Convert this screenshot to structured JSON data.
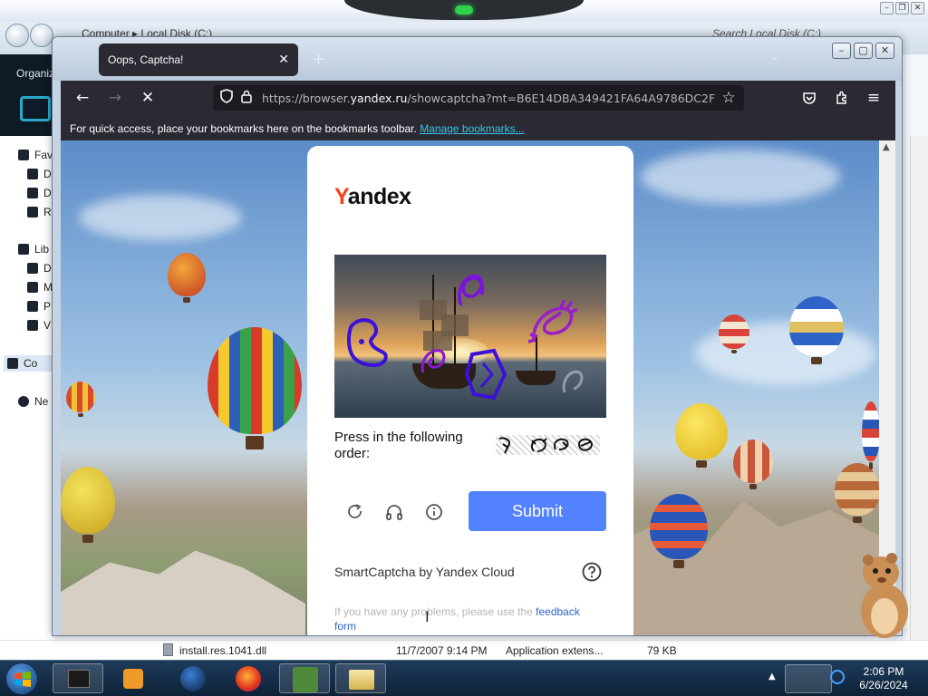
{
  "explorer": {
    "breadcrumbs": [
      "Computer",
      "Local Disk (C:)"
    ],
    "search_placeholder": "Search Local Disk (C:)",
    "toolbar_organize": "Organiz",
    "sidebar": [
      {
        "label": "Fav",
        "kind": "group"
      },
      {
        "label": "D",
        "kind": "item"
      },
      {
        "label": "D",
        "kind": "item"
      },
      {
        "label": "R",
        "kind": "item"
      },
      {
        "label": "Lib",
        "kind": "group"
      },
      {
        "label": "D",
        "kind": "item"
      },
      {
        "label": "M",
        "kind": "item"
      },
      {
        "label": "P",
        "kind": "item"
      },
      {
        "label": "V",
        "kind": "item"
      },
      {
        "label": "Co",
        "kind": "selected"
      },
      {
        "label": "Ne",
        "kind": "group"
      }
    ],
    "file_row": {
      "name": "install.res.1041.dll",
      "date": "11/7/2007 9:14 PM",
      "type": "Application extens...",
      "size": "79 KB"
    }
  },
  "browser": {
    "tab_title": "Oops, Captcha!",
    "url_prefix": "https://browser.",
    "url_host": "yandex.ru",
    "url_rest": "/showcaptcha?mt=B6E14DBA349421FA64A9786DC2F",
    "bookmarks_message": "For quick access, place your bookmarks here on the bookmarks toolbar.",
    "bookmarks_link": "Manage bookmarks..."
  },
  "captcha": {
    "logo_first": "Y",
    "logo_rest": "andex",
    "instruction": "Press in the following order:",
    "submit_label": "Submit",
    "provider": "SmartCaptcha by Yandex Cloud",
    "problem_text": "If you have any problems, please use the",
    "feedback_link": "feedback form",
    "shape_color": "#3b10d8",
    "shape_color_alt": "#9b1ec8"
  },
  "taskbar": {
    "time": "2:06 PM",
    "date": "6/26/2024"
  }
}
